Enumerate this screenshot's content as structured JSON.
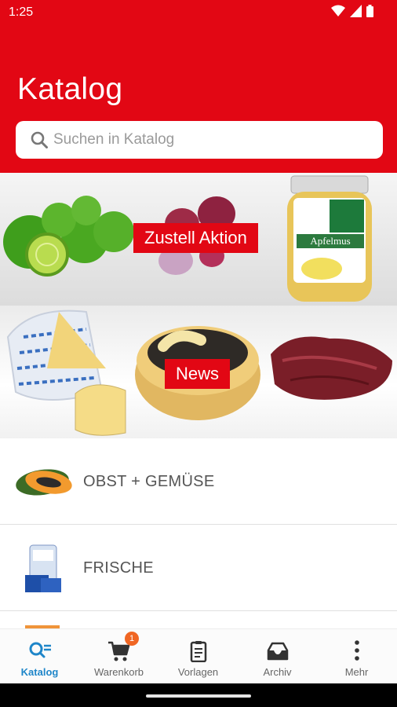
{
  "status": {
    "time": "1:25"
  },
  "header": {
    "title": "Katalog",
    "search_placeholder": "Suchen in Katalog",
    "brand_color": "#e20714"
  },
  "banners": [
    {
      "label": "Zustell Aktion",
      "images": [
        "limes",
        "red-onions",
        "apple-sauce-jar"
      ],
      "jar_label": "Apfelmus"
    },
    {
      "label": "News",
      "images": [
        "cheese-wheel",
        "cheese-round",
        "raw-meat"
      ]
    }
  ],
  "categories": [
    {
      "label": "OBST + GEMÜSE",
      "icon": "papaya-icon"
    },
    {
      "label": "FRISCHE",
      "icon": "fresh-dairy-icon"
    }
  ],
  "bottom_nav": {
    "active": "Katalog",
    "accent": "#1f86c9",
    "cart_badge": "1",
    "items": [
      {
        "label": "Katalog",
        "icon": "catalog-search-icon"
      },
      {
        "label": "Warenkorb",
        "icon": "cart-icon"
      },
      {
        "label": "Vorlagen",
        "icon": "clipboard-icon"
      },
      {
        "label": "Archiv",
        "icon": "archive-inbox-icon"
      },
      {
        "label": "Mehr",
        "icon": "more-vertical-icon"
      }
    ]
  }
}
